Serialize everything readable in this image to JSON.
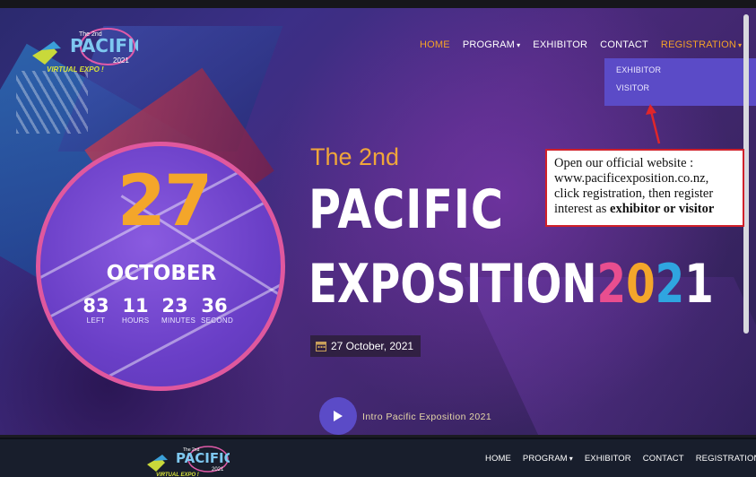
{
  "nav": {
    "items": [
      {
        "label": "HOME",
        "active": true
      },
      {
        "label": "PROGRAM",
        "dropdown": true
      },
      {
        "label": "EXHIBITOR"
      },
      {
        "label": "CONTACT"
      },
      {
        "label": "REGISTRATION",
        "dropdown": true,
        "highlight": true
      }
    ],
    "registration_menu": [
      "EXHIBITOR",
      "VISITOR"
    ]
  },
  "logo": {
    "line1": "The 2nd",
    "brand": "PACIFIC",
    "tag": "VIRTUAL EXPO !",
    "year": "2021"
  },
  "event": {
    "day": "27",
    "month": "OCTOBER",
    "countdown": [
      {
        "value": "83",
        "label": "LEFT"
      },
      {
        "value": "11",
        "label": "HOURS"
      },
      {
        "value": "23",
        "label": "MINUTES"
      },
      {
        "value": "36",
        "label": "SECOND"
      }
    ],
    "subtitle": "The 2nd",
    "title_line1": "PACIFIC",
    "title_line2": "EXPOSITION",
    "year_digits": [
      "2",
      "0",
      "2",
      "1"
    ],
    "date_label": "27 October, 2021",
    "intro_label": "Intro Pacific Exposition 2021"
  },
  "callout": {
    "text_plain": "Open our official website : www.pacificexposition.co.nz, click registration, then register interest as ",
    "text_bold": "exhibitor or visitor"
  },
  "footer_nav": {
    "items": [
      {
        "label": "HOME"
      },
      {
        "label": "PROGRAM",
        "dropdown": true
      },
      {
        "label": "EXHIBITOR"
      },
      {
        "label": "CONTACT"
      },
      {
        "label": "REGISTRATION",
        "dropdown": true
      }
    ]
  },
  "colors": {
    "accent_orange": "#f4a62a",
    "dropdown_purple": "#5b4bc7",
    "year_pink": "#e94e8f",
    "year_blue": "#2fa5e0",
    "callout_border": "#d0202a"
  },
  "icons": {
    "caret": "caret-down-icon",
    "calendar": "calendar-icon",
    "play": "play-icon",
    "arrow": "red-arrow-icon"
  }
}
